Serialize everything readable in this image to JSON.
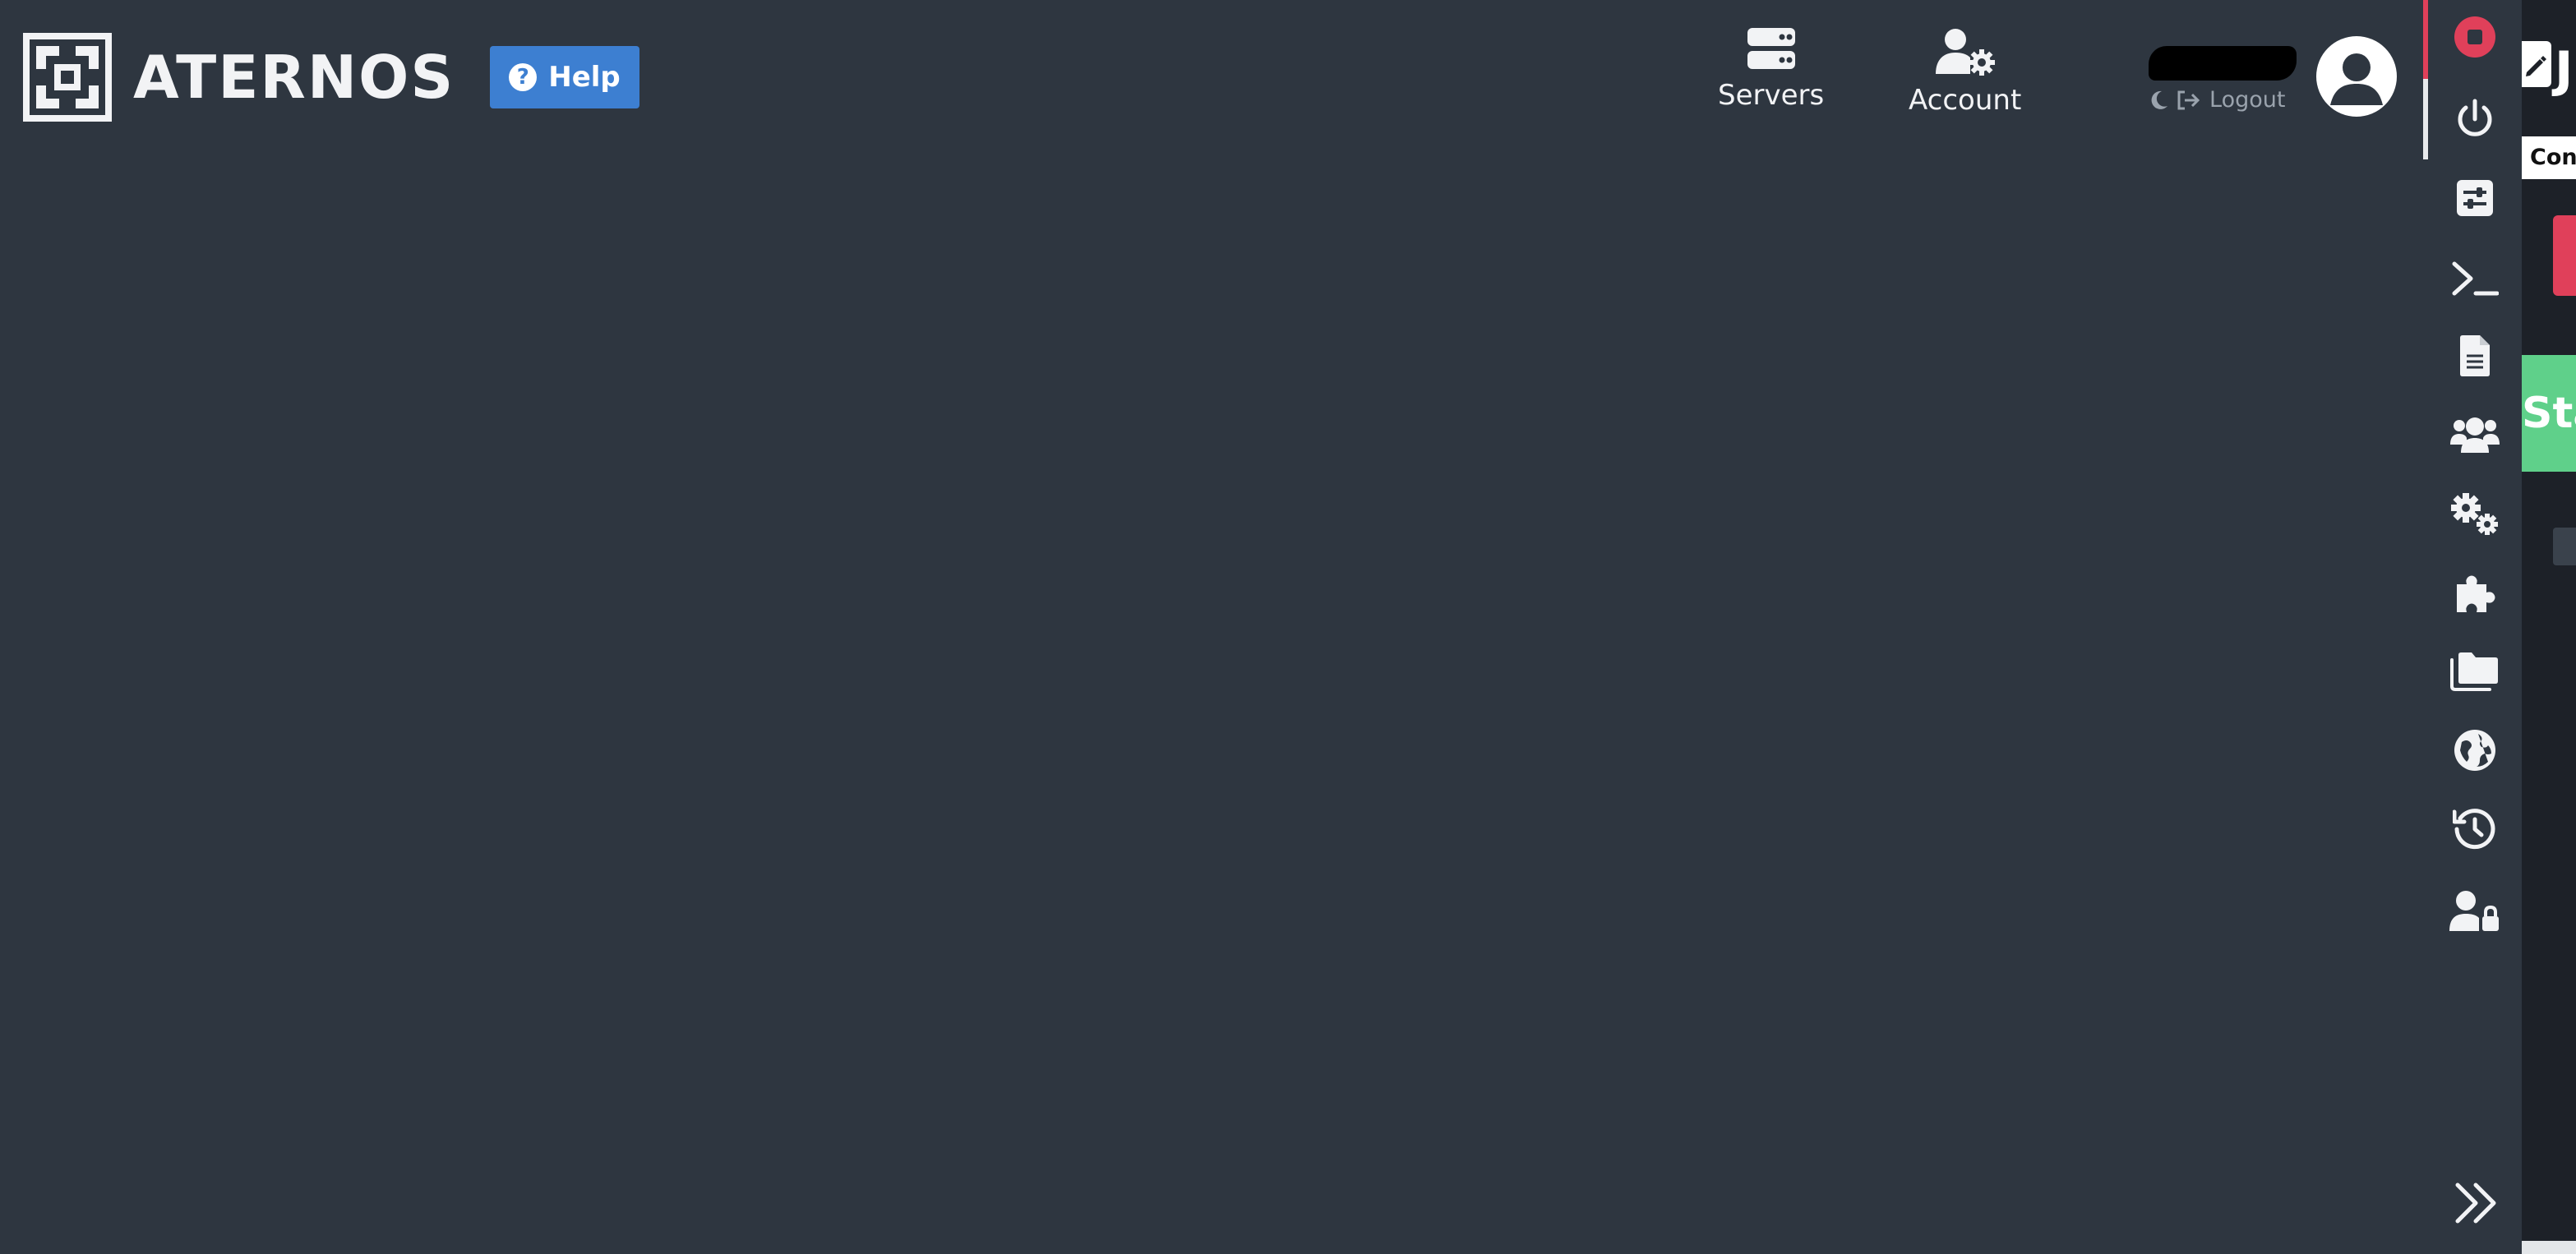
{
  "brand": {
    "name": "ATERNOS"
  },
  "header": {
    "help_label": "Help",
    "nav": {
      "servers_label": "Servers",
      "account_label": "Account"
    },
    "user": {
      "logout_label": "Logout"
    }
  },
  "sidebar": {
    "items": [
      {
        "icon": "stop-icon",
        "active": true
      },
      {
        "icon": "power-icon"
      },
      {
        "icon": "options-icon"
      },
      {
        "icon": "console-icon"
      },
      {
        "icon": "log-file-icon"
      },
      {
        "icon": "players-icon"
      },
      {
        "icon": "settings-icon"
      },
      {
        "icon": "plugins-icon"
      },
      {
        "icon": "files-icon"
      },
      {
        "icon": "worlds-icon"
      },
      {
        "icon": "backups-icon"
      },
      {
        "icon": "access-icon"
      }
    ],
    "collapse_icon": "double-chevron-right-icon"
  },
  "right_panel": {
    "title_fragment": "J",
    "tooltip_fragment": "Conn",
    "start_button_fragment": "Sta"
  },
  "colors": {
    "background": "#2e3640",
    "help_blue": "#3d7fd1",
    "stop_red": "#e0405a",
    "start_green": "#5fd08a"
  }
}
